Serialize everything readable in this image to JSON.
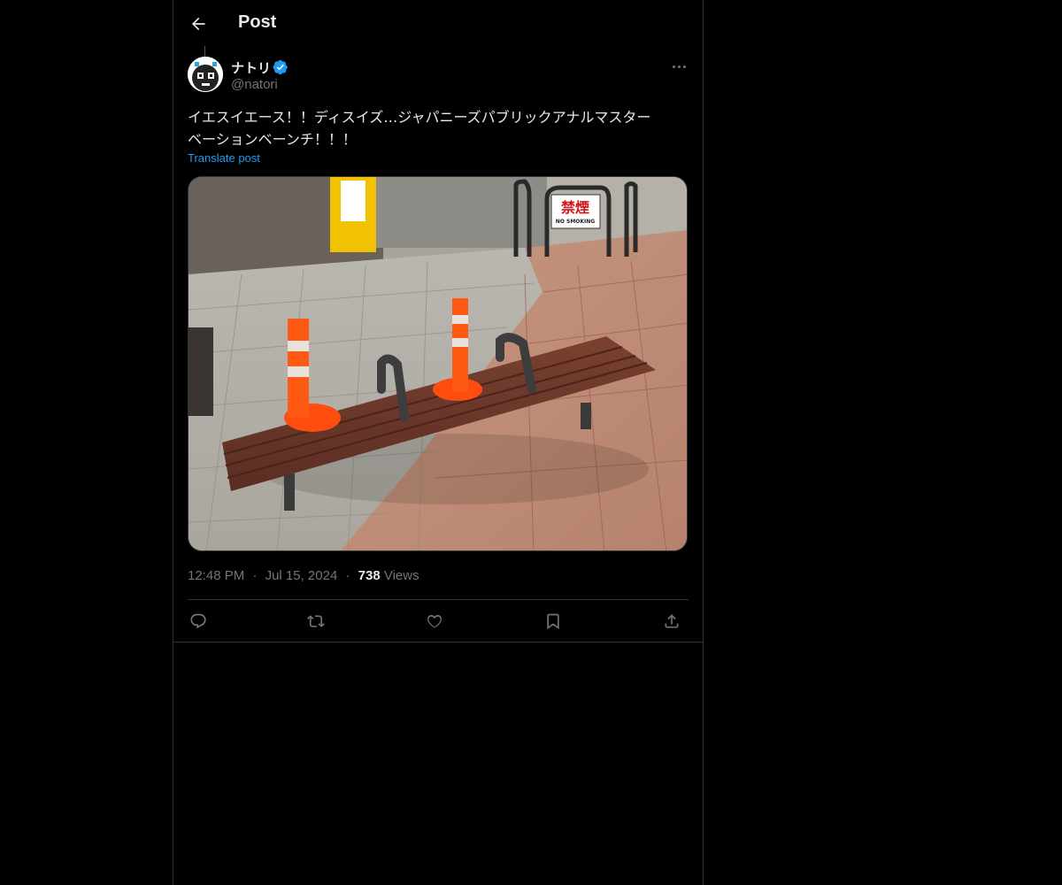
{
  "header": {
    "title": "Post"
  },
  "author": {
    "name": "ナトリ",
    "handle": "@natori",
    "verified": true
  },
  "post": {
    "text_line1": "イエスイエース！！ディスイズ…ジャパニーズパブリックアナルマスター",
    "text_line2": "ベーションベーンチ！！！",
    "translate_label": "Translate post"
  },
  "media": {
    "sign_text": "禁煙",
    "sign_subtext": "NO SMOKING"
  },
  "meta": {
    "time": "12:48 PM",
    "separator": "·",
    "date": "Jul 15, 2024",
    "views_count": "738",
    "views_label": "Views"
  },
  "actions": [
    "reply-icon",
    "repost-icon",
    "like-icon",
    "bookmark-icon",
    "share-icon"
  ],
  "colors": {
    "background": "#000000",
    "text": "#e7e9ea",
    "muted": "#71767b",
    "accent": "#1d9bf0",
    "border": "#2f3336"
  }
}
